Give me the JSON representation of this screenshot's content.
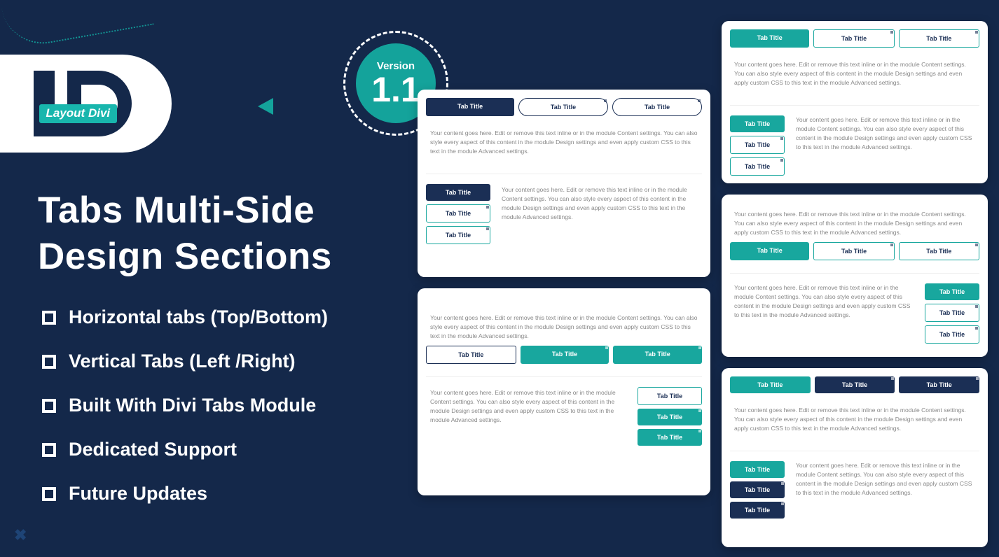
{
  "logo": {
    "text": "Layout Divi"
  },
  "version": {
    "label": "Version",
    "number": "1.1"
  },
  "headline": {
    "line1": "Tabs Multi-Side",
    "line2": "Design Sections"
  },
  "features": [
    "Horizontal tabs (Top/Bottom)",
    "Vertical Tabs (Left /Right)",
    "Built With Divi Tabs Module",
    "Dedicated Support",
    "Future Updates"
  ],
  "tab_label": "Tab Title",
  "body_text": "Your content goes here. Edit or remove this text inline or in the module Content settings. You can also style every aspect of this content in the module Design settings and even apply custom CSS to this text in the module Advanced settings."
}
